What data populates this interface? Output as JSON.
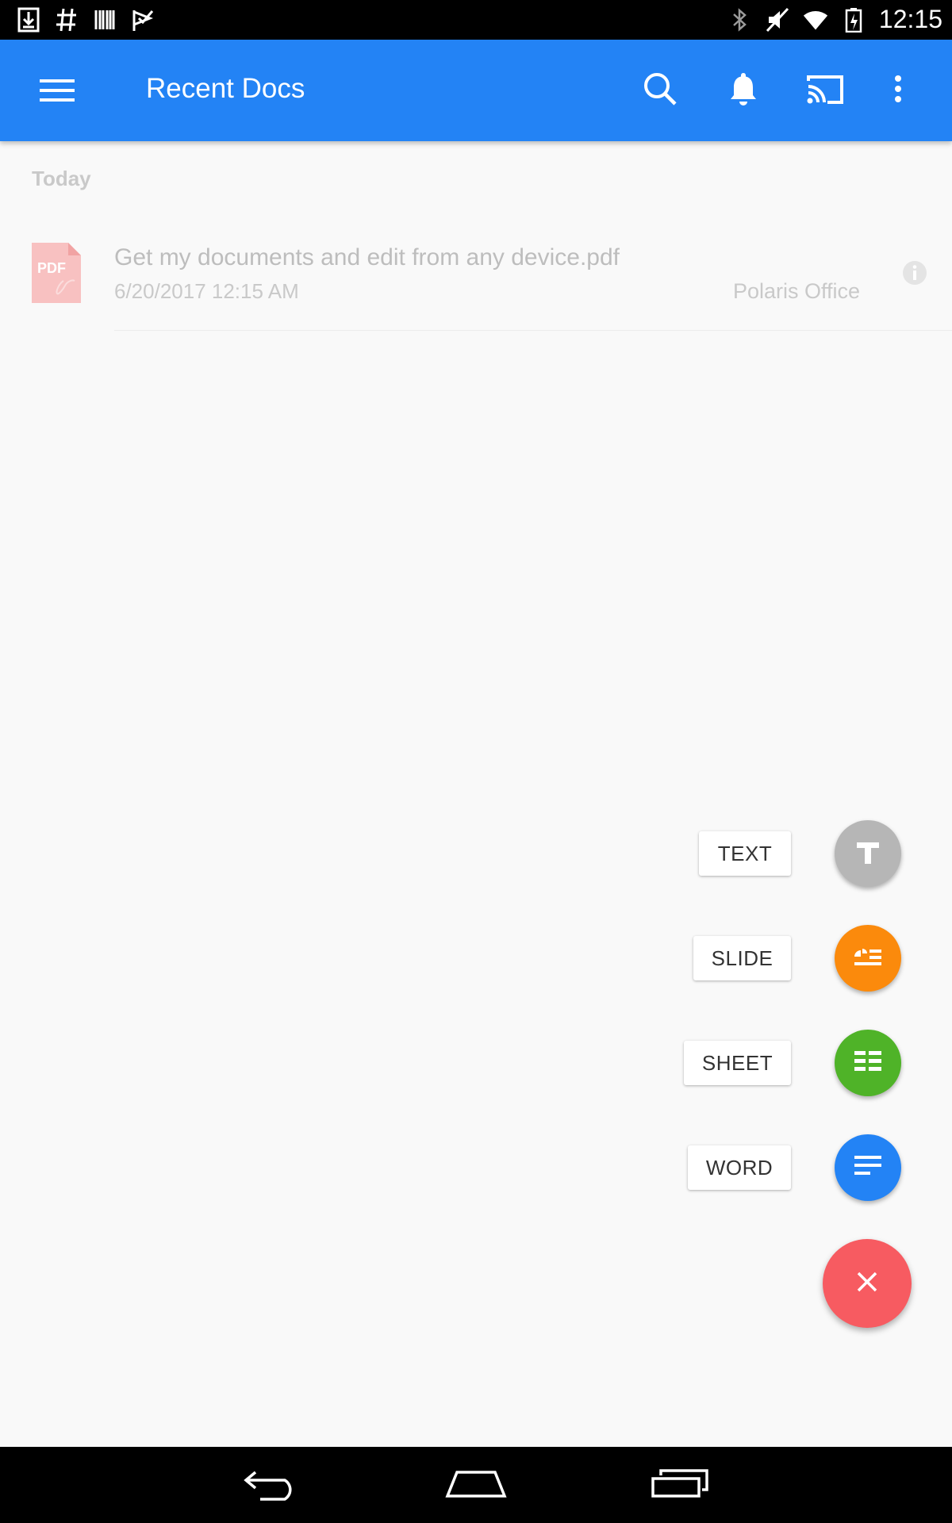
{
  "status_bar": {
    "time": "12:15",
    "left_icons": [
      "download-icon",
      "hashtag-icon",
      "barcode-icon",
      "checkmark-flag-icon"
    ],
    "right_icons": [
      "bluetooth-icon",
      "mute-icon",
      "wifi-icon",
      "battery-icon"
    ]
  },
  "app_bar": {
    "title": "Recent Docs",
    "color": "#2383f5",
    "actions": [
      "search-icon",
      "bell-icon",
      "cast-icon",
      "more-vert-icon"
    ]
  },
  "section": {
    "header": "Today"
  },
  "documents": [
    {
      "icon_label": "PDF",
      "name": "Get my documents and edit from any device.pdf",
      "date": "6/20/2017 12:15 AM",
      "source": "Polaris Office"
    }
  ],
  "fab_menu": {
    "items": [
      {
        "label": "TEXT",
        "color": "#b6b6b6",
        "icon": "text-icon"
      },
      {
        "label": "SLIDE",
        "color": "#fb8a0c",
        "icon": "slide-icon"
      },
      {
        "label": "SHEET",
        "color": "#4fb328",
        "icon": "sheet-icon"
      },
      {
        "label": "WORD",
        "color": "#2383f5",
        "icon": "word-icon"
      }
    ],
    "close": {
      "icon": "close-icon",
      "color": "#f75b61"
    }
  },
  "nav_bar": [
    "back-icon",
    "home-icon",
    "recents-icon"
  ]
}
